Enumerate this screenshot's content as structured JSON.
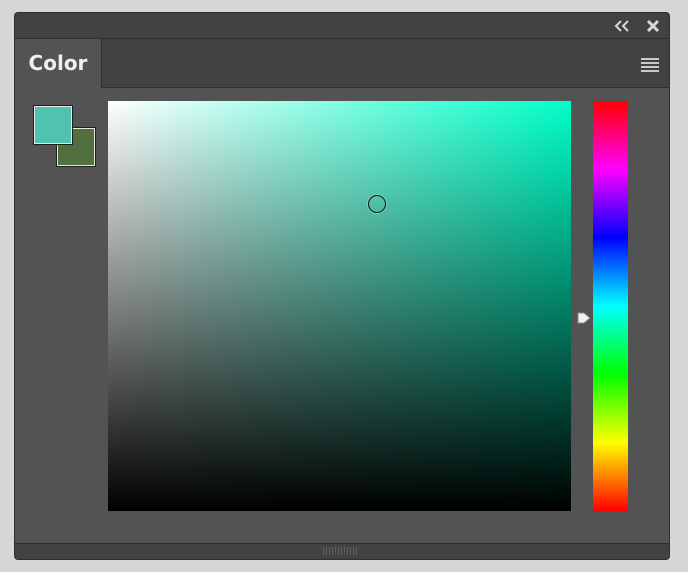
{
  "panel": {
    "tab_label": "Color",
    "icons": {
      "collapse": "double-chevron-left-icon",
      "close": "close-icon",
      "menu": "hamburger-menu-icon",
      "grip": "resize-grip-icon"
    }
  },
  "colors": {
    "foreground": "#52c2b0",
    "background": "#52703e",
    "field_hue": "#00ffc8",
    "panel_bg": "#535353",
    "panel_dark": "#424242"
  },
  "picker": {
    "saturation": 0.58,
    "brightness": 0.75
  },
  "hue": {
    "position": 0.53
  }
}
